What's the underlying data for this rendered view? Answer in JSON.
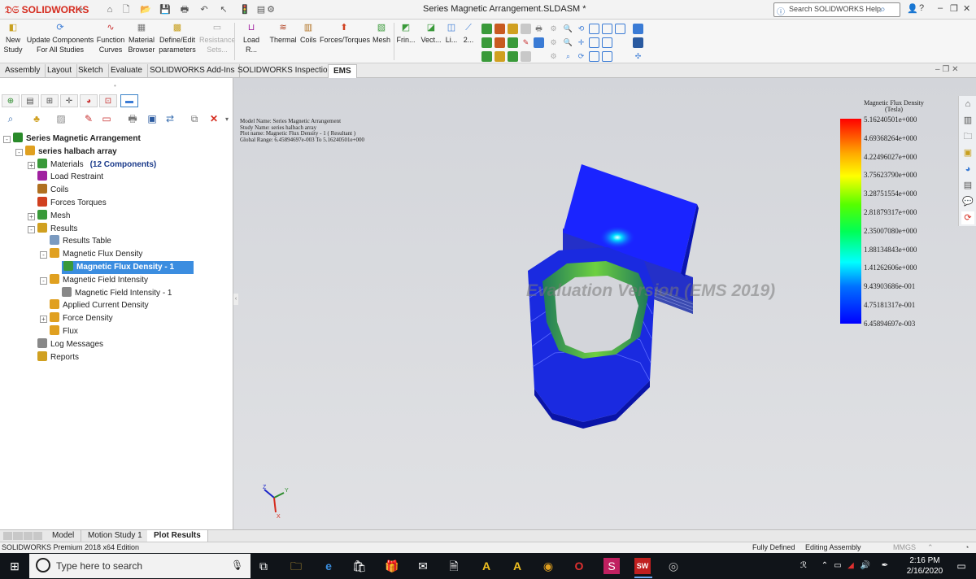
{
  "app": {
    "logo": "SOLIDWORKS",
    "title": "Series Magnetic Arrangement.SLDASM *",
    "help_placeholder": "Search SOLIDWORKS Help"
  },
  "commands": [
    {
      "label": "New Study",
      "icon": "new-study-icon",
      "color": "#c8a020"
    },
    {
      "label": "Update Components For All Studies",
      "icon": "update-components-icon",
      "color": "#3a7bd5"
    },
    {
      "label": "Function Curves",
      "icon": "function-curves-icon",
      "color": "#c83030"
    },
    {
      "label": "Material Browser",
      "icon": "material-browser-icon",
      "color": "#777777"
    },
    {
      "label": "Define/Edit parameters",
      "icon": "parameters-icon",
      "color": "#c8a020"
    },
    {
      "label": "Resistance Sets...",
      "icon": "resistance-sets-icon",
      "color": "#aaaaaa"
    },
    {
      "label": "Load R...",
      "icon": "load-restraint-icon",
      "color": "#a020a0"
    },
    {
      "label": "Thermal",
      "icon": "thermal-icon",
      "color": "#b04020"
    },
    {
      "label": "Coils",
      "icon": "coils-icon",
      "color": "#b07020"
    },
    {
      "label": "Forces/Torques",
      "icon": "forces-torques-icon",
      "color": "#d04020"
    },
    {
      "label": "Mesh",
      "icon": "mesh-icon",
      "color": "#3a9a3a"
    },
    {
      "label": "Frin...",
      "icon": "fringe-icon",
      "color": "#3a9a3a"
    },
    {
      "label": "Vect...",
      "icon": "vector-icon",
      "color": "#3a9a3a"
    },
    {
      "label": "Li...",
      "icon": "line-plot-icon",
      "color": "#3a7bd5"
    },
    {
      "label": "2...",
      "icon": "2d-plot-icon",
      "color": "#3a7bd5"
    }
  ],
  "tabs": [
    "Assembly",
    "Layout",
    "Sketch",
    "Evaluate",
    "SOLIDWORKS Add-Ins",
    "SOLIDWORKS Inspection",
    "EMS"
  ],
  "tree": [
    {
      "label": "Series Magnetic Arrangement",
      "icon": "assembly-icon",
      "color": "#2a8a2a",
      "level": 0,
      "exp": "-",
      "bold": true
    },
    {
      "label": "series halbach array",
      "icon": "study-icon",
      "color": "#e0a020",
      "level": 1,
      "exp": "-",
      "bold": true
    },
    {
      "label": "Materials",
      "extra": "(12 Components)",
      "icon": "materials-icon",
      "color": "#3a9a3a",
      "level": 2,
      "exp": "+"
    },
    {
      "label": "Load Restraint",
      "icon": "load-restraint-icon",
      "color": "#a020a0",
      "level": 2
    },
    {
      "label": "Coils",
      "icon": "coils-icon",
      "color": "#b07020",
      "level": 2
    },
    {
      "label": "Forces Torques",
      "icon": "forces-torques-icon",
      "color": "#d04020",
      "level": 2
    },
    {
      "label": "Mesh",
      "icon": "mesh-icon",
      "color": "#3a9a3a",
      "level": 2,
      "exp": "+"
    },
    {
      "label": "Results",
      "icon": "results-icon",
      "color": "#d0a020",
      "level": 2,
      "exp": "-"
    },
    {
      "label": "Results Table",
      "icon": "results-table-icon",
      "color": "#7a9ac0",
      "level": 3
    },
    {
      "label": "Magnetic Flux Density",
      "icon": "flux-density-icon",
      "color": "#e0a020",
      "level": 3,
      "exp": "-"
    },
    {
      "label": "Magnetic Flux Density - 1",
      "icon": "flux-plot-icon",
      "color": "#3a9a3a",
      "level": 4,
      "selected": true
    },
    {
      "label": "Magnetic Field Intensity",
      "icon": "field-intensity-icon",
      "color": "#e0a020",
      "level": 3,
      "exp": "-"
    },
    {
      "label": "Magnetic Field Intensity - 1",
      "icon": "field-plot-icon",
      "color": "#888888",
      "level": 4
    },
    {
      "label": "Applied Current Density",
      "icon": "current-density-icon",
      "color": "#e0a020",
      "level": 3
    },
    {
      "label": "Force Density",
      "icon": "force-density-icon",
      "color": "#e0a020",
      "level": 3,
      "exp": "+"
    },
    {
      "label": "Flux",
      "icon": "flux-icon",
      "color": "#e0a020",
      "level": 3
    },
    {
      "label": "Log Messages",
      "icon": "log-messages-icon",
      "color": "#888888",
      "level": 2
    },
    {
      "label": "Reports",
      "icon": "reports-icon",
      "color": "#d0a020",
      "level": 2
    }
  ],
  "plot_info": [
    "Model Name: Series Magnetic Arrangement",
    "Study Name: series halbach array",
    "Plot name: Magnetic Flux Density - 1 ( Resultant )",
    "Global Range: 6.45894697e-003 To 5.16240501e+000"
  ],
  "watermark": "Evaluation Version (EMS 2019)",
  "legend": {
    "title_line1": "Magnetic Flux Density",
    "title_line2": "(Tesla)",
    "labels": [
      "5.16240501e+000",
      "4.69368264e+000",
      "4.22496027e+000",
      "3.75623790e+000",
      "3.28751554e+000",
      "2.81879317e+000",
      "2.35007080e+000",
      "1.88134843e+000",
      "1.41262606e+000",
      "9.43903686e-001",
      "4.75181317e-001",
      "6.45894697e-003"
    ]
  },
  "triad": {
    "x": "X",
    "y": "Y",
    "z": "Z"
  },
  "bottom_tabs": [
    "Model",
    "Motion Study 1",
    "Plot Results"
  ],
  "status": {
    "edition": "SOLIDWORKS Premium 2018 x64 Edition",
    "defined": "Fully Defined",
    "mode": "Editing Assembly",
    "units": "MMGS"
  },
  "taskbar": {
    "search_placeholder": "Type here to search",
    "time": "2:16 PM",
    "date": "2/16/2020"
  }
}
